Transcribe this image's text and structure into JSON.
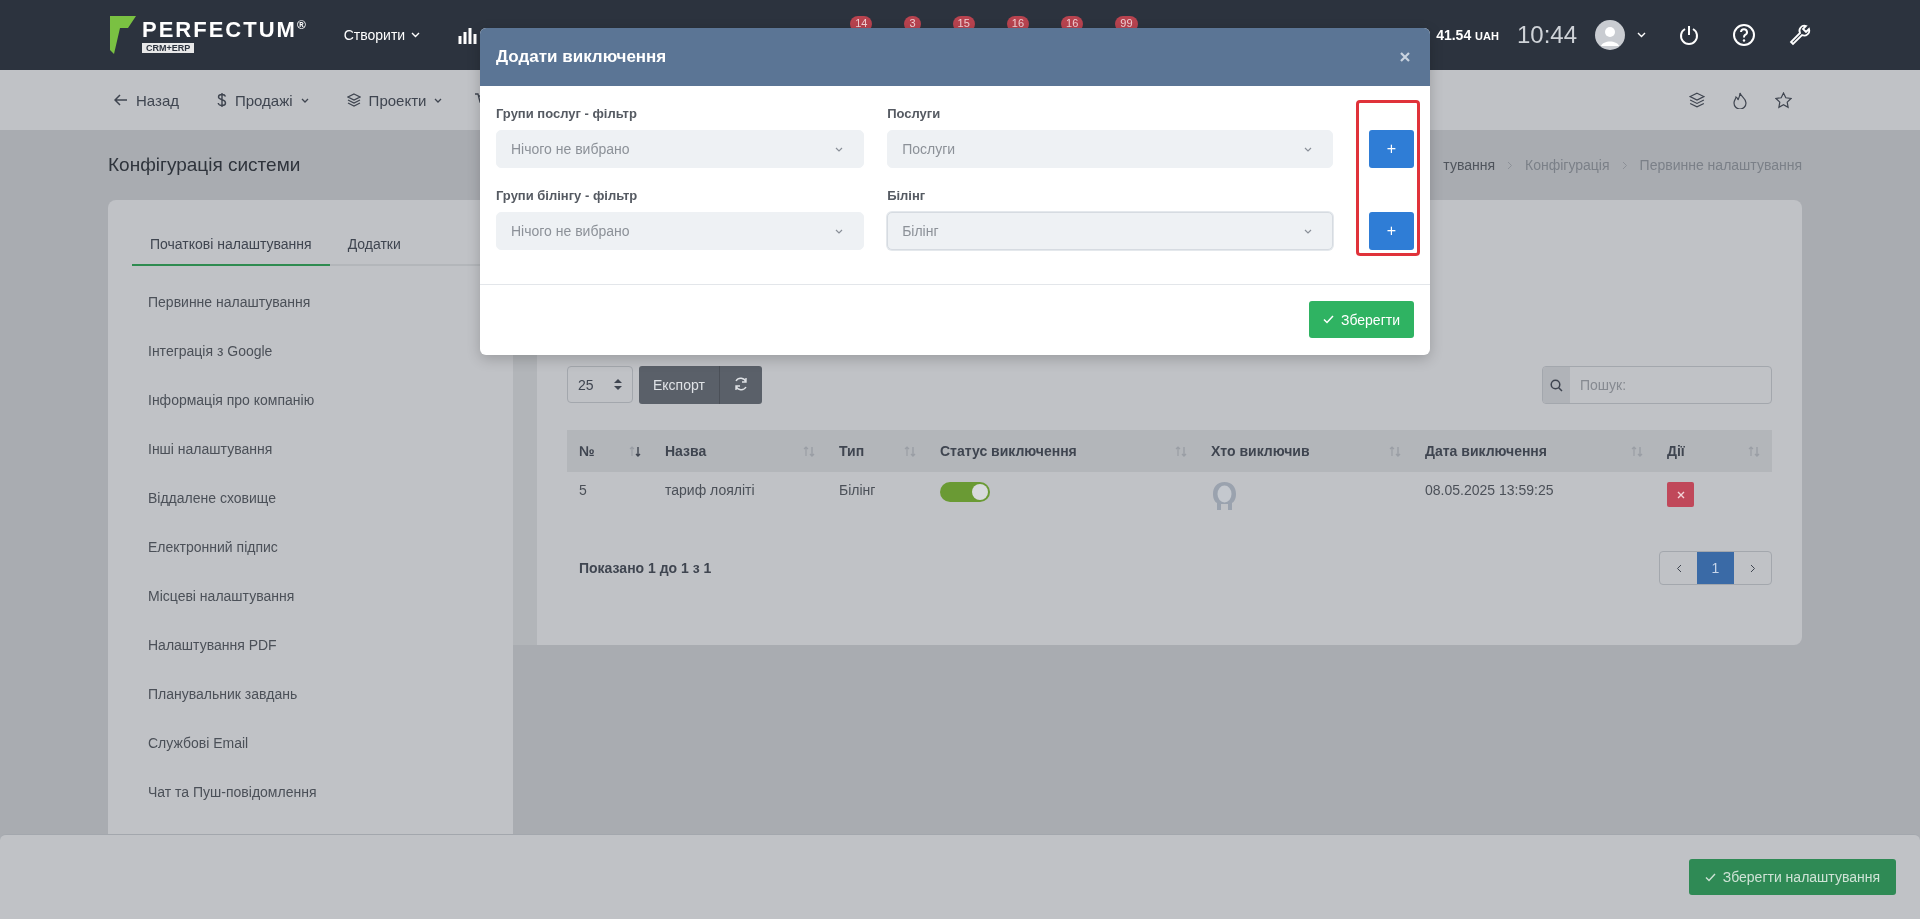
{
  "topbar": {
    "logo": {
      "name": "PERFECTUM",
      "mark": "®",
      "tagline": "CRM+ERP"
    },
    "create_menu": "Створити",
    "badges": [
      "14",
      "3",
      "15",
      "16",
      "16",
      "99"
    ],
    "balance": {
      "amount": "41.54",
      "currency": "UAH"
    },
    "time": "10:44"
  },
  "nav": {
    "items": [
      {
        "label": "Назад",
        "kind": "back"
      },
      {
        "label": "Продажі",
        "kind": "dollar"
      },
      {
        "label": "Проекти",
        "kind": "layers"
      }
    ]
  },
  "page_title": "Конфігурація системи",
  "breadcrumbs": [
    "тування",
    "Конфігурація",
    "Первинне налаштування"
  ],
  "settings": {
    "tabs": [
      {
        "label": "Початкові налаштування",
        "selected": true
      },
      {
        "label": "Додатки",
        "selected": false
      }
    ],
    "menu": [
      "Первинне налаштування",
      "Інтеграція з Google",
      "Інформація про компанію",
      "Інші налаштування",
      "Віддалене сховище",
      "Електронний підпис",
      "Місцеві налаштування",
      "Налаштування PDF",
      "Планувальник завдань",
      "Службові Email",
      "Чат та Пуш-повідомлення"
    ]
  },
  "table": {
    "page_size": "25",
    "export": "Експорт",
    "search_placeholder": "Пошук:",
    "columns": [
      {
        "label": "№",
        "sorted": true
      },
      {
        "label": "Назва",
        "sorted": false
      },
      {
        "label": "Тип",
        "sorted": false
      },
      {
        "label": "Статус виключення",
        "sorted": false
      },
      {
        "label": "Хто виключив",
        "sorted": false
      },
      {
        "label": "Дата виключення",
        "sorted": false
      },
      {
        "label": "Дії",
        "sorted": false
      }
    ],
    "rows": [
      {
        "number": "5",
        "name": "тариф лояліті",
        "type": "Білінг",
        "enabled": true,
        "date": "08.05.2025 13:59:25"
      }
    ],
    "info": "Показано 1 до 1 з 1",
    "pages": [
      {
        "label": "1",
        "selected": true
      }
    ]
  },
  "modal": {
    "title": "Додати виключення",
    "fields": [
      {
        "label": "Групи послуг - фільтр",
        "placeholder": "Нічого не вибрано",
        "focused": false
      },
      {
        "label": "Послуги",
        "placeholder": "Послуги",
        "focused": false
      },
      {
        "label": "Групи білінгу - фільтр",
        "placeholder": "Нічого не вибрано",
        "focused": false
      },
      {
        "label": "Білінг",
        "placeholder": "Білінг",
        "focused": true
      }
    ],
    "add_buttons": [
      "+",
      "+"
    ],
    "save": "Зберегти"
  },
  "footer": {
    "save": "Зберегти налаштування"
  }
}
